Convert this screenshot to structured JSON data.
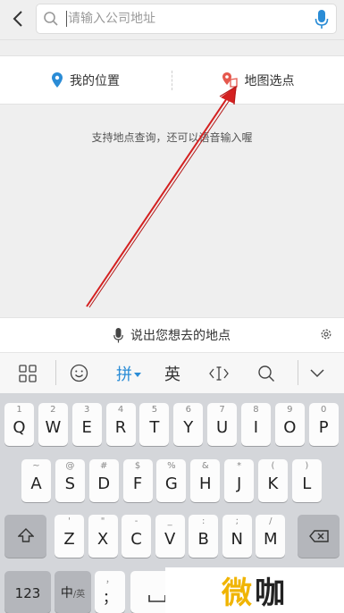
{
  "search": {
    "placeholder": "请输入公司地址"
  },
  "location": {
    "my_location": "我的位置",
    "map_pick": "地图选点"
  },
  "hint": "支持地点查询，还可以语音输入喔",
  "voice": {
    "label": "说出您想去的地点"
  },
  "toolbar": {
    "pinyin": "拼",
    "english": "英"
  },
  "keyboard": {
    "row1": [
      {
        "sub": "1",
        "main": "Q"
      },
      {
        "sub": "2",
        "main": "W"
      },
      {
        "sub": "3",
        "main": "E"
      },
      {
        "sub": "4",
        "main": "R"
      },
      {
        "sub": "5",
        "main": "T"
      },
      {
        "sub": "6",
        "main": "Y"
      },
      {
        "sub": "7",
        "main": "U"
      },
      {
        "sub": "8",
        "main": "I"
      },
      {
        "sub": "9",
        "main": "O"
      },
      {
        "sub": "0",
        "main": "P"
      }
    ],
    "row2": [
      {
        "sub": "~",
        "main": "A"
      },
      {
        "sub": "@",
        "main": "S"
      },
      {
        "sub": "#",
        "main": "D"
      },
      {
        "sub": "$",
        "main": "F"
      },
      {
        "sub": "%",
        "main": "G"
      },
      {
        "sub": "&",
        "main": "H"
      },
      {
        "sub": "*",
        "main": "J"
      },
      {
        "sub": "(",
        "main": "K"
      },
      {
        "sub": ")",
        "main": "L"
      }
    ],
    "row3": [
      {
        "sub": "'",
        "main": "Z"
      },
      {
        "sub": "\"",
        "main": "X"
      },
      {
        "sub": "-",
        "main": "C"
      },
      {
        "sub": "_",
        "main": "V"
      },
      {
        "sub": ":",
        "main": "B"
      },
      {
        "sub": ";",
        "main": "N"
      },
      {
        "sub": "/",
        "main": "M"
      }
    ],
    "num_key": "123",
    "lang_key_main": "中",
    "lang_key_sub": "/英",
    "comma_sub": "，",
    "comma_main": "；"
  },
  "watermark": {
    "part1": "微",
    "part2": "咖"
  },
  "colors": {
    "accent": "#2a8cd6",
    "arrow": "#d42020",
    "pin_blue": "#2a8cd6",
    "pin_red": "#e5584d"
  }
}
